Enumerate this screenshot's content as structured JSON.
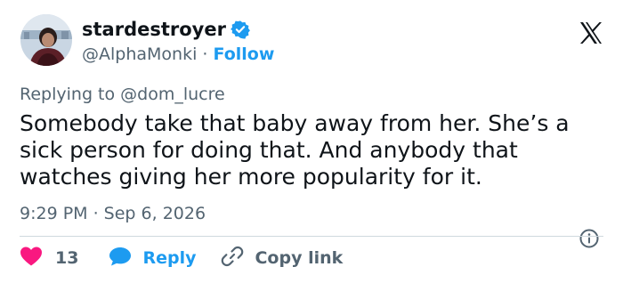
{
  "author": {
    "display_name": "stardestroyer",
    "handle": "@AlphaMonki",
    "separator": "·",
    "follow_label": "Follow"
  },
  "tweet": {
    "replying_to": "Replying to @dom_lucre",
    "text": "Somebody take that baby away from her. She’s a sick person for doing that. And anybody that watches giving her more popularity for it.",
    "timestamp": "9:29 PM · Sep 6, 2026"
  },
  "actions": {
    "like_count": "13",
    "reply_label": "Reply",
    "copy_link_label": "Copy link"
  },
  "colors": {
    "accent": "#1d9bf0",
    "like": "#f91880",
    "secondary_text": "#536471",
    "divider": "#cfd9de"
  },
  "icons": [
    "verified-badge-icon",
    "x-logo-icon",
    "info-icon",
    "heart-icon",
    "reply-bubble-icon",
    "link-icon"
  ]
}
